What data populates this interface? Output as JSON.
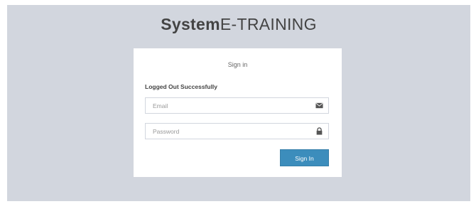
{
  "logo": {
    "bold": "System",
    "light": "E-TRAINING"
  },
  "login_box": {
    "title": "Sign in",
    "status_message": "Logged Out Successfully",
    "email_placeholder": "Email",
    "password_placeholder": "Password",
    "submit_label": "Sign In"
  },
  "icons": {
    "email": "envelope-icon",
    "password": "lock-icon"
  },
  "colors": {
    "background": "#d2d6de",
    "button": "#3c8dbc"
  }
}
